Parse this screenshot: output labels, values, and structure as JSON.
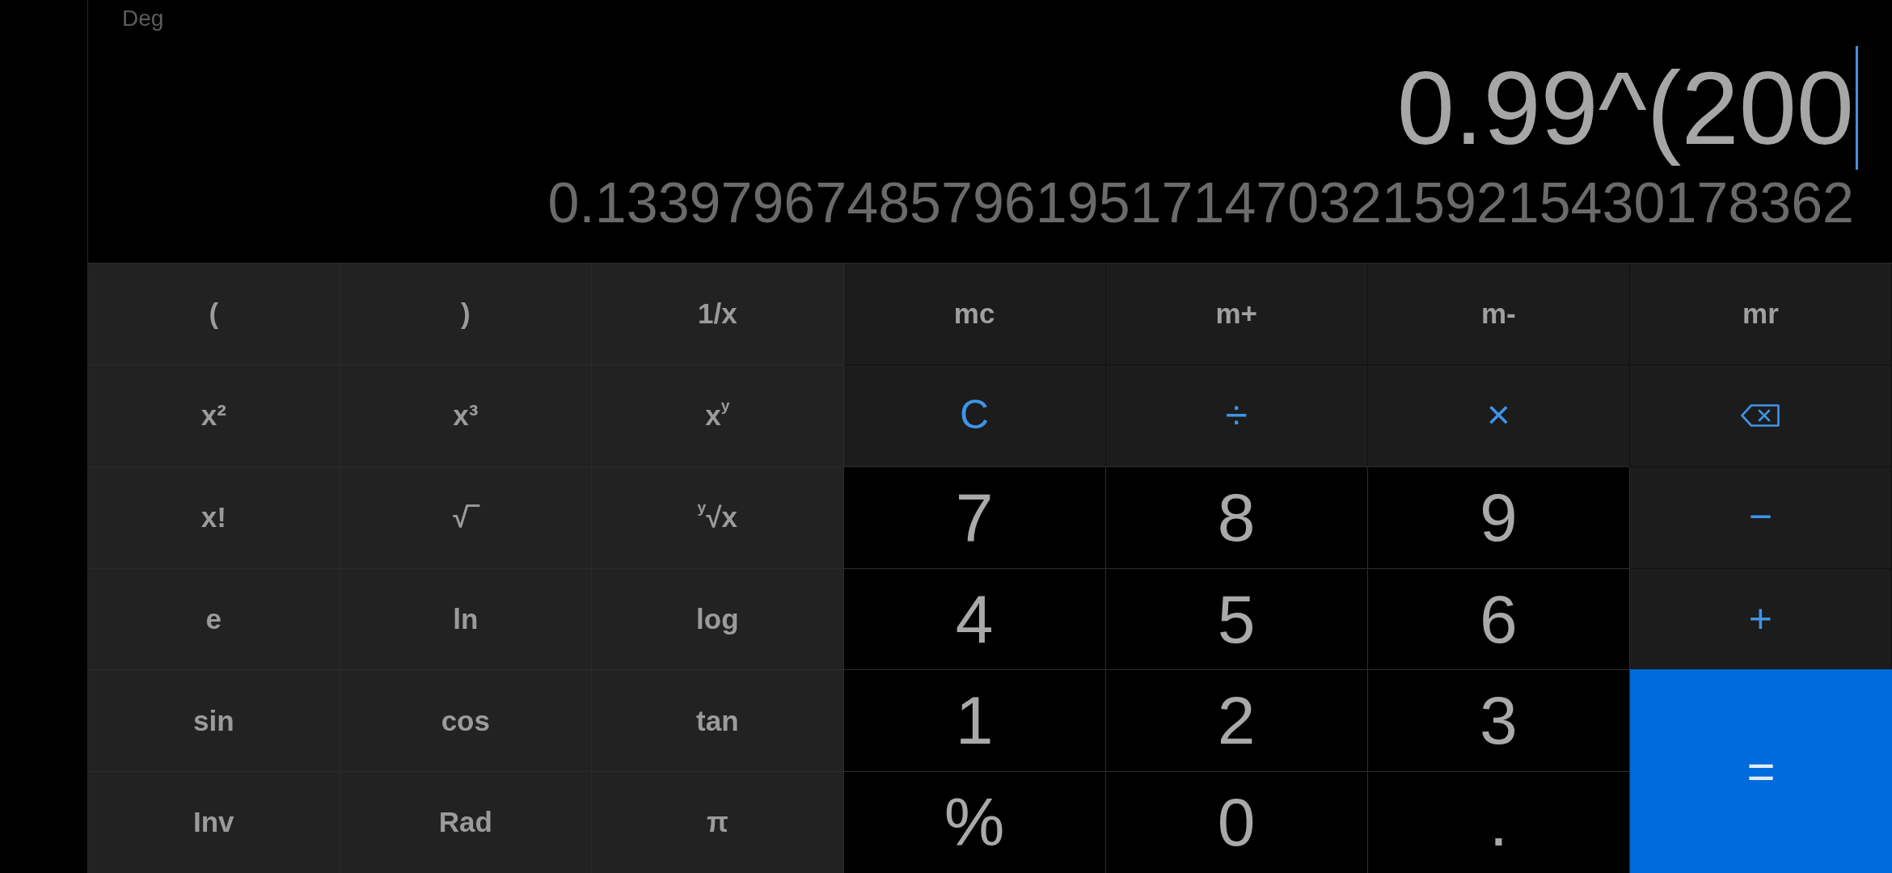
{
  "display": {
    "angle_mode": "Deg",
    "expression": "0.99^(200",
    "result": "0.1339796748579619517147032159215430178362"
  },
  "scientific_keys": [
    {
      "label": "("
    },
    {
      "label": ")"
    },
    {
      "label": "1/x"
    },
    {
      "label": "x²"
    },
    {
      "label": "x³"
    },
    {
      "label": "x$^{y}$"
    },
    {
      "label": "x!"
    },
    {
      "label": "√‾"
    },
    {
      "label": "$^{y}$√x"
    },
    {
      "label": "e"
    },
    {
      "label": "ln"
    },
    {
      "label": "log"
    },
    {
      "label": "sin"
    },
    {
      "label": "cos"
    },
    {
      "label": "tan"
    },
    {
      "label": "Inv"
    },
    {
      "label": "Rad"
    },
    {
      "label": "π"
    }
  ],
  "main_keys": [
    {
      "kind": "memory",
      "label": "mc"
    },
    {
      "kind": "memory",
      "label": "m+"
    },
    {
      "kind": "memory",
      "label": "m-"
    },
    {
      "kind": "memory",
      "label": "mr"
    },
    {
      "kind": "clear",
      "label": "C"
    },
    {
      "kind": "operator",
      "label": "÷"
    },
    {
      "kind": "operator",
      "label": "×"
    },
    {
      "kind": "backspace"
    },
    {
      "kind": "number",
      "label": "7"
    },
    {
      "kind": "number",
      "label": "8"
    },
    {
      "kind": "number",
      "label": "9"
    },
    {
      "kind": "operator",
      "label": "−"
    },
    {
      "kind": "number",
      "label": "4"
    },
    {
      "kind": "number",
      "label": "5"
    },
    {
      "kind": "number",
      "label": "6"
    },
    {
      "kind": "operator",
      "label": "+"
    },
    {
      "kind": "number",
      "label": "1"
    },
    {
      "kind": "number",
      "label": "2"
    },
    {
      "kind": "number",
      "label": "3"
    },
    {
      "kind": "equals",
      "label": "="
    },
    {
      "kind": "percent",
      "label": "%"
    },
    {
      "kind": "number",
      "label": "0"
    },
    {
      "kind": "point",
      "label": "."
    }
  ]
}
